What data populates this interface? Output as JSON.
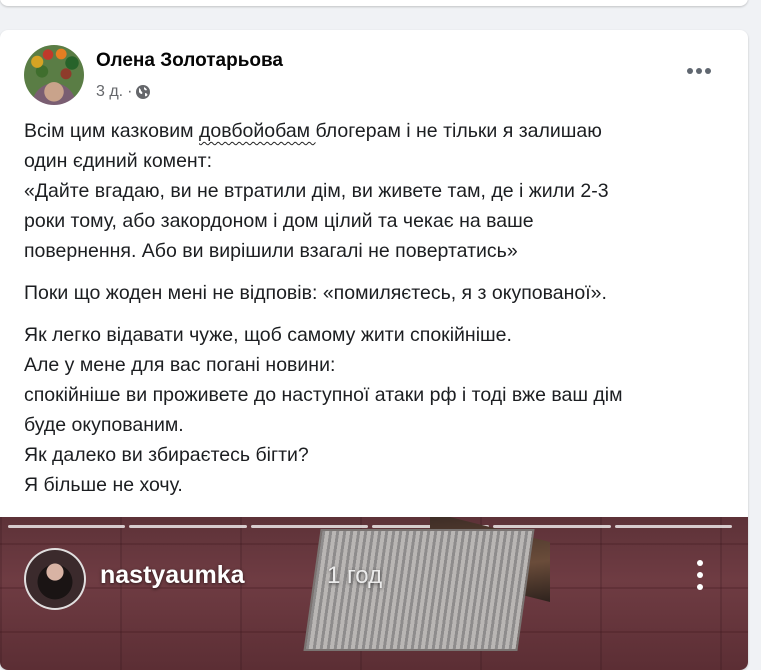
{
  "post": {
    "author": "Олена Золотарьова",
    "time": "3 д.",
    "separator": "·",
    "privacy_icon": "globe-icon",
    "more_icon": "more-options-icon",
    "text": {
      "line1_before": "Всім цим казковим ",
      "scribbled": "довбойобам ",
      "line1_after": " блогерам і не тільки я залишаю",
      "line2": "один єдиний комент:",
      "line3": "«Дайте вгадаю, ви не втратили дім, ви живете там, де і жили 2-3",
      "line4": "роки тому, або закордоном і дом цілий та чекає на ваше",
      "line5": "повернення. Або ви вирішили взагалі не повертатись»",
      "para2": "Поки що жоден мені не відповів: «помиляєтесь, я з окупованої».",
      "para3_line1": "Як легко відавати чуже, щоб самому жити спокійніше.",
      "para3_line2": "Але у мене для вас погані новини:",
      "para3_line3": "спокійніше ви проживете до наступної атаки рф і тоді вже ваш дім",
      "para3_line4": "буде окупованим.",
      "para3_line5": "Як далеко ви збираєтесь бігти?",
      "para3_line6": "Я більше не хочу."
    }
  },
  "media": {
    "story_username": "nastyaumka",
    "story_time": "1 год",
    "story_more_icon": "story-more-icon",
    "progress_segments": 6
  },
  "colors": {
    "background": "#f0f2f5",
    "card": "#ffffff",
    "text": "#1c1e21",
    "muted": "#65676b"
  }
}
